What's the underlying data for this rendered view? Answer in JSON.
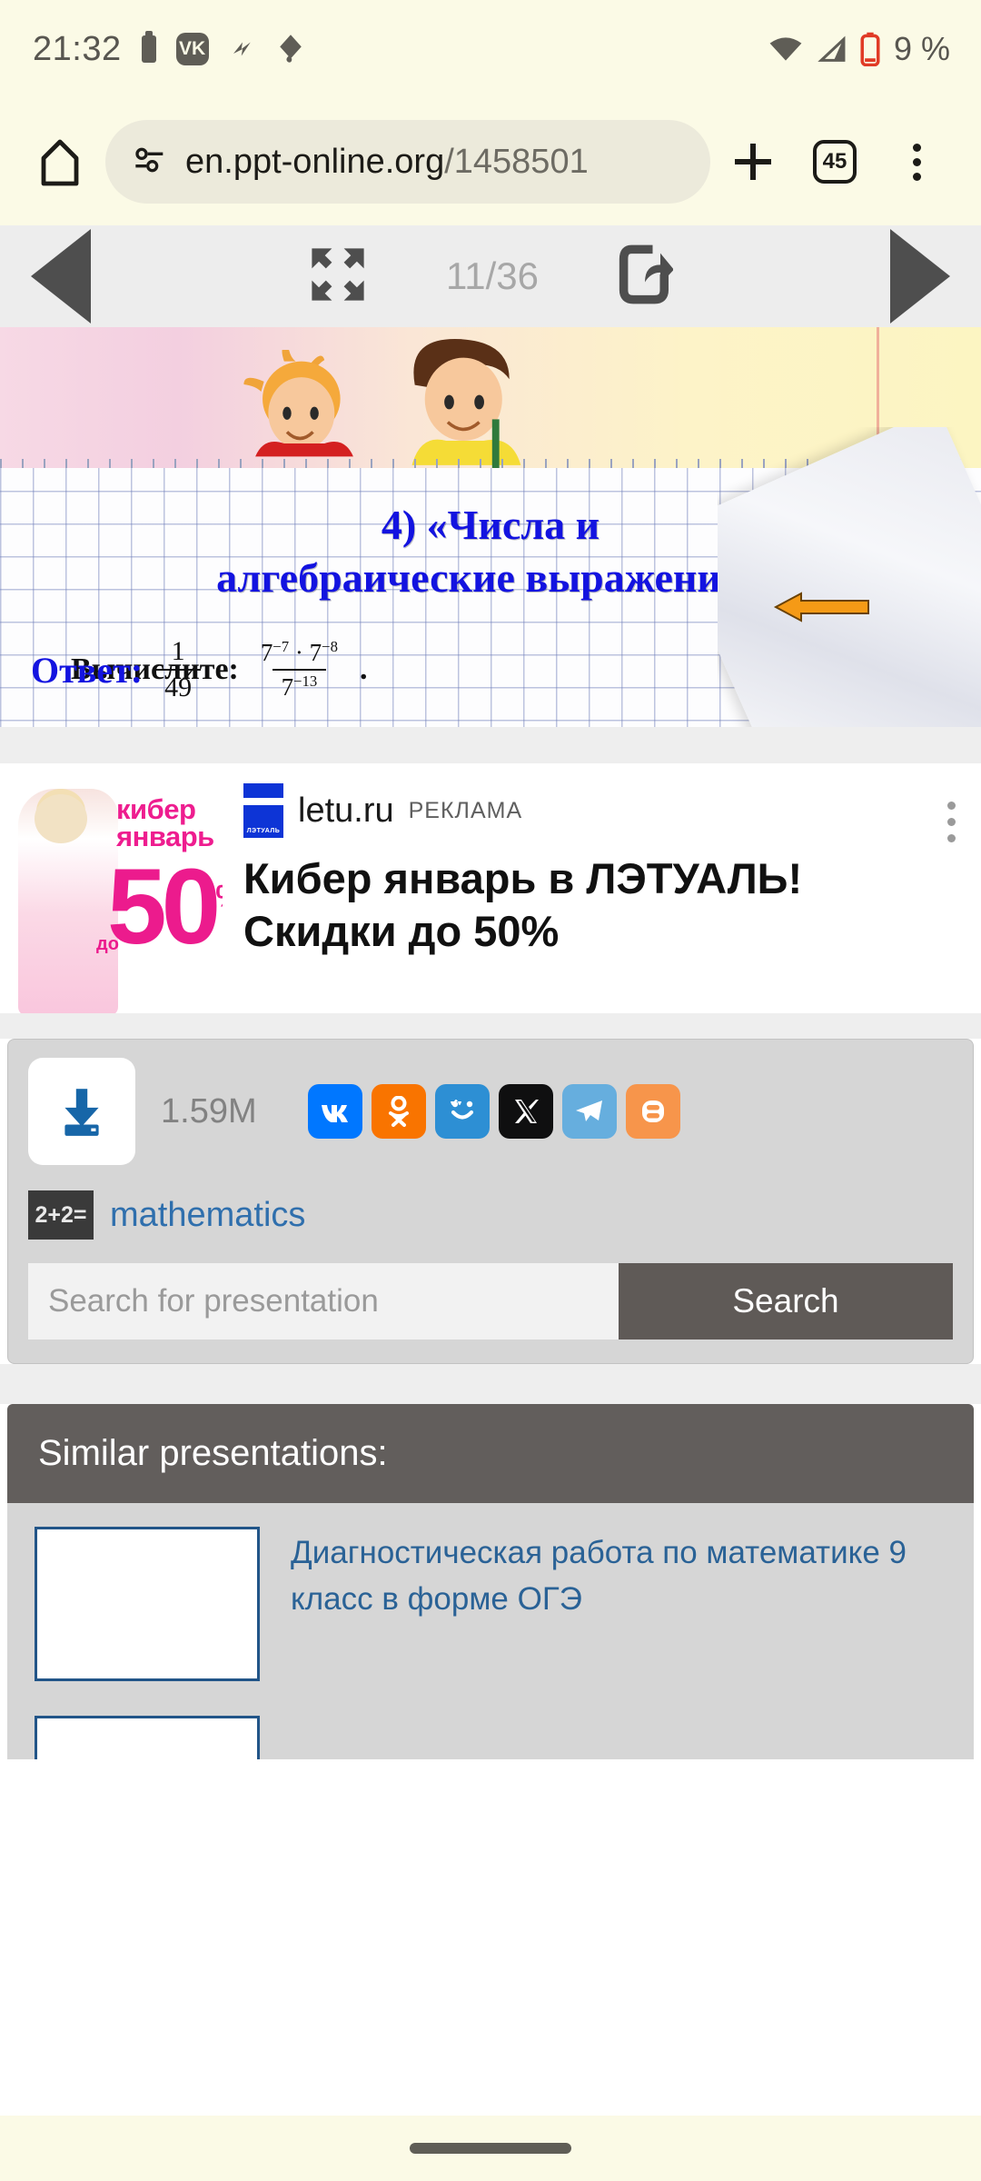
{
  "status_bar": {
    "clock": "21:32",
    "battery_percent": "9 %",
    "icons": [
      "battery-icon",
      "vk-icon",
      "notification-icon",
      "pen-icon",
      "wifi-icon",
      "cellular-icon",
      "battery-low-icon"
    ]
  },
  "browser": {
    "home_icon": "home-icon",
    "site_info_icon": "site-settings-icon",
    "url_main": "en.ppt-online.org",
    "url_suffix": "/1458501",
    "new_tab_label": "+",
    "tab_count": "45",
    "menu_icon": "overflow-menu-icon"
  },
  "slide_nav": {
    "prev_label": "prev-slide",
    "fullscreen_label": "fullscreen",
    "page_indicator": "11/36",
    "share_label": "share",
    "next_label": "next-slide"
  },
  "slide": {
    "title_line1": "4)  «Числа и",
    "title_line2": "алгебраические  выражения»",
    "prompt": "Вычислите:",
    "formula": {
      "numerator": "7⁻⁷ · 7⁻⁸",
      "denominator": "7⁻¹³",
      "num_base1": "7",
      "num_exp1": "−7",
      "num_dot": "·",
      "num_base2": "7",
      "num_exp2": "−8",
      "den_base": "7",
      "den_exp": "−13",
      "trailing": "."
    },
    "answer_label": "Ответ:",
    "answer_numerator": "1",
    "answer_denominator": "49",
    "colors": {
      "title": "#1313e0",
      "answer": "#1313e0",
      "arrow": "#f59a16"
    }
  },
  "ad": {
    "brand": "letu.ru",
    "label": "РЕКЛАМА",
    "headline_line1": "Кибер январь в ЛЭТУАЛЬ!",
    "headline_line2": "Скидки до 50%",
    "creative_top": "кибер",
    "creative_top2": "январь",
    "creative_discount": "50",
    "creative_pct": "%",
    "creative_do": "до",
    "logo_text": "ЛЭТУАЛЬ",
    "menu_icon": "ad-options-icon"
  },
  "share": {
    "download_icon": "download-icon",
    "file_size": "1.59M",
    "socials": [
      {
        "name": "vk",
        "glyph": "VK",
        "color": "#0077ff"
      },
      {
        "name": "odnoklassniki",
        "glyph": "OK",
        "color": "#f97400"
      },
      {
        "name": "mail-ru",
        "glyph": "☺",
        "color": "#2d8fd4"
      },
      {
        "name": "x-twitter",
        "glyph": "X",
        "color": "#0f0f10"
      },
      {
        "name": "telegram",
        "glyph": "➤",
        "color": "#66aede"
      },
      {
        "name": "blogger",
        "glyph": "B",
        "color": "#f7954b"
      }
    ],
    "tag_icon_text": "2+2=",
    "tag_label": "mathematics",
    "search_placeholder": "Search for presentation",
    "search_value": "",
    "search_button": "Search"
  },
  "similar": {
    "heading": "Similar presentations:",
    "items": [
      {
        "title": "Диагностическая работа по математике 9 класс в форме ОГЭ"
      },
      {
        "title": ""
      }
    ]
  }
}
